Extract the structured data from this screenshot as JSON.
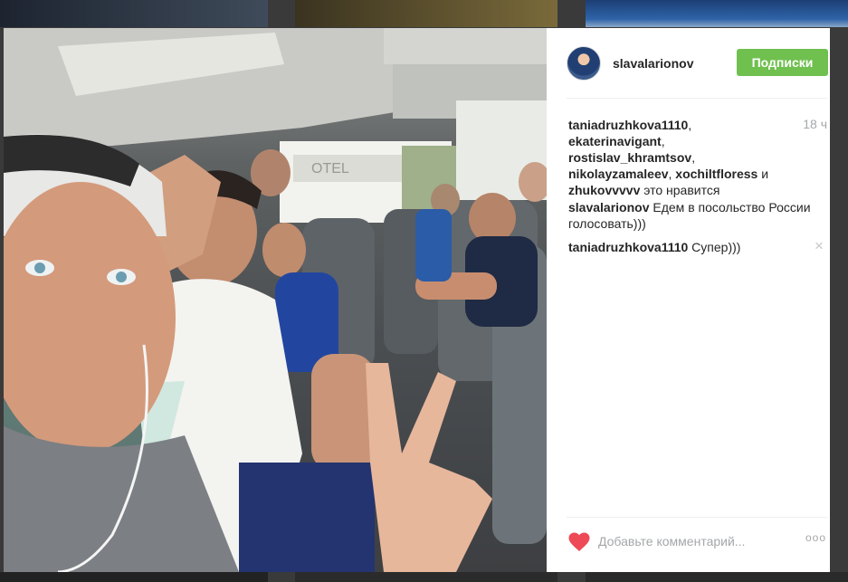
{
  "post": {
    "username": "slavalarionov",
    "follow_label": "Подписки",
    "likes": {
      "users": [
        "taniadruzhkova1110",
        "ekaterinavigant",
        "rostislav_khramtsov",
        "nikolayzamaleev",
        "xochiltfloress",
        "zhukovvvvv"
      ],
      "sep1": ", ",
      "sep2": ", ",
      "sep3": ",",
      "sep4": ", ",
      "and": " и",
      "suffix": " это нравится"
    },
    "time": "18 ч",
    "comments": [
      {
        "user": "slavalarionov",
        "text": " Едем в посольство России голосовать)))"
      },
      {
        "user": "taniadruzhkova1110",
        "text": " Супер)))"
      }
    ],
    "comment_close": "×",
    "add_comment_placeholder": "Добавьте комментарий...",
    "more": "ooo",
    "photo_sign": "OTEL"
  },
  "colors": {
    "follow_button": "#70c050",
    "heart": "#ed4956",
    "muted_text": "#a5a7aa"
  },
  "icons": {
    "heart": "heart-icon",
    "more": "more-options-icon",
    "close": "close-icon"
  }
}
